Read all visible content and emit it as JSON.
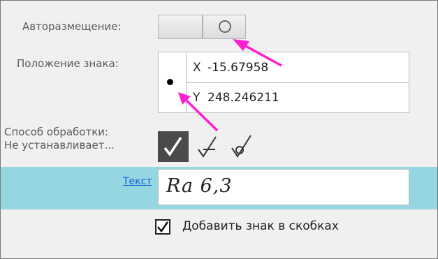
{
  "autoplacement": {
    "label": "Авторазмещение:"
  },
  "position": {
    "label": "Положение знака:",
    "x_label": "X",
    "x_value": "-15.67958",
    "y_label": "Y",
    "y_value": "248.246211"
  },
  "processing": {
    "label": "Способ обработки:",
    "status": "Не устанавливает..."
  },
  "text": {
    "link": "Текст",
    "value": "Ra 6,3"
  },
  "brackets": {
    "label": "Добавить знак в скобках",
    "checked": true
  },
  "colors": {
    "accent_band": "#96d6e0",
    "arrow": "#ff1fd0",
    "link": "#0b5fd8"
  }
}
